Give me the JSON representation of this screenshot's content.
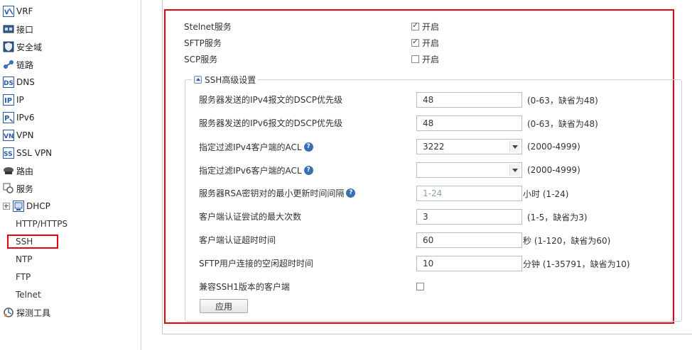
{
  "sidebar": {
    "items": [
      {
        "label": "VRF",
        "icon": "vrf-icon"
      },
      {
        "label": "接口",
        "icon": "interface-icon"
      },
      {
        "label": "安全域",
        "icon": "security-zone-icon"
      },
      {
        "label": "链路",
        "icon": "link-icon"
      },
      {
        "label": "DNS",
        "icon": "dns-icon"
      },
      {
        "label": "IP",
        "icon": "ip-icon"
      },
      {
        "label": "IPv6",
        "icon": "ipv6-icon"
      },
      {
        "label": "VPN",
        "icon": "vpn-icon"
      },
      {
        "label": "SSL VPN",
        "icon": "ssl-vpn-icon"
      },
      {
        "label": "路由",
        "icon": "route-icon"
      },
      {
        "label": "服务",
        "icon": "service-icon"
      },
      {
        "label": "DHCP",
        "icon": "dhcp-icon"
      }
    ],
    "sub_items": [
      "HTTP/HTTPS",
      "SSH",
      "NTP",
      "FTP",
      "Telnet"
    ],
    "tools": {
      "label": "探测工具",
      "icon": "probe-tool-icon"
    }
  },
  "services": [
    {
      "label": "Stelnet服务",
      "option": "开启",
      "checked": true
    },
    {
      "label": "SFTP服务",
      "option": "开启",
      "checked": true
    },
    {
      "label": "SCP服务",
      "option": "开启",
      "checked": false
    }
  ],
  "advanced": {
    "legend": "SSH高级设置",
    "fields": [
      {
        "label": "服务器发送的IPv4报文的DSCP优先级",
        "value": "48",
        "hint": "(0-63，缺省为48)"
      },
      {
        "label": "服务器发送的IPv6报文的DSCP优先级",
        "value": "48",
        "hint": "(0-63，缺省为48)"
      },
      {
        "label": "指定过滤IPv4客户端的ACL",
        "value": "3222",
        "hint": "(2000-4999)"
      },
      {
        "label": "指定过滤IPv6客户端的ACL",
        "value": "",
        "hint": "(2000-4999)"
      },
      {
        "label": "服务器RSA密钥对的最小更新时间间隔",
        "placeholder": "1-24",
        "hint": "小时 (1-24)"
      },
      {
        "label": "客户端认证尝试的最大次数",
        "value": "3",
        "hint": "(1-5，缺省为3)"
      },
      {
        "label": "客户端认证超时时间",
        "value": "60",
        "hint": "秒 (1-120，缺省为60)"
      },
      {
        "label": "SFTP用户连接的空闲超时时间",
        "value": "10",
        "hint": "分钟 (1-35791，缺省为10)"
      },
      {
        "label": "兼容SSH1版本的客户端",
        "checked": false
      }
    ],
    "apply_label": "应用"
  },
  "help_glyph": "?",
  "colors": {
    "highlight": "#e60012",
    "accent": "#3a6fb5"
  }
}
